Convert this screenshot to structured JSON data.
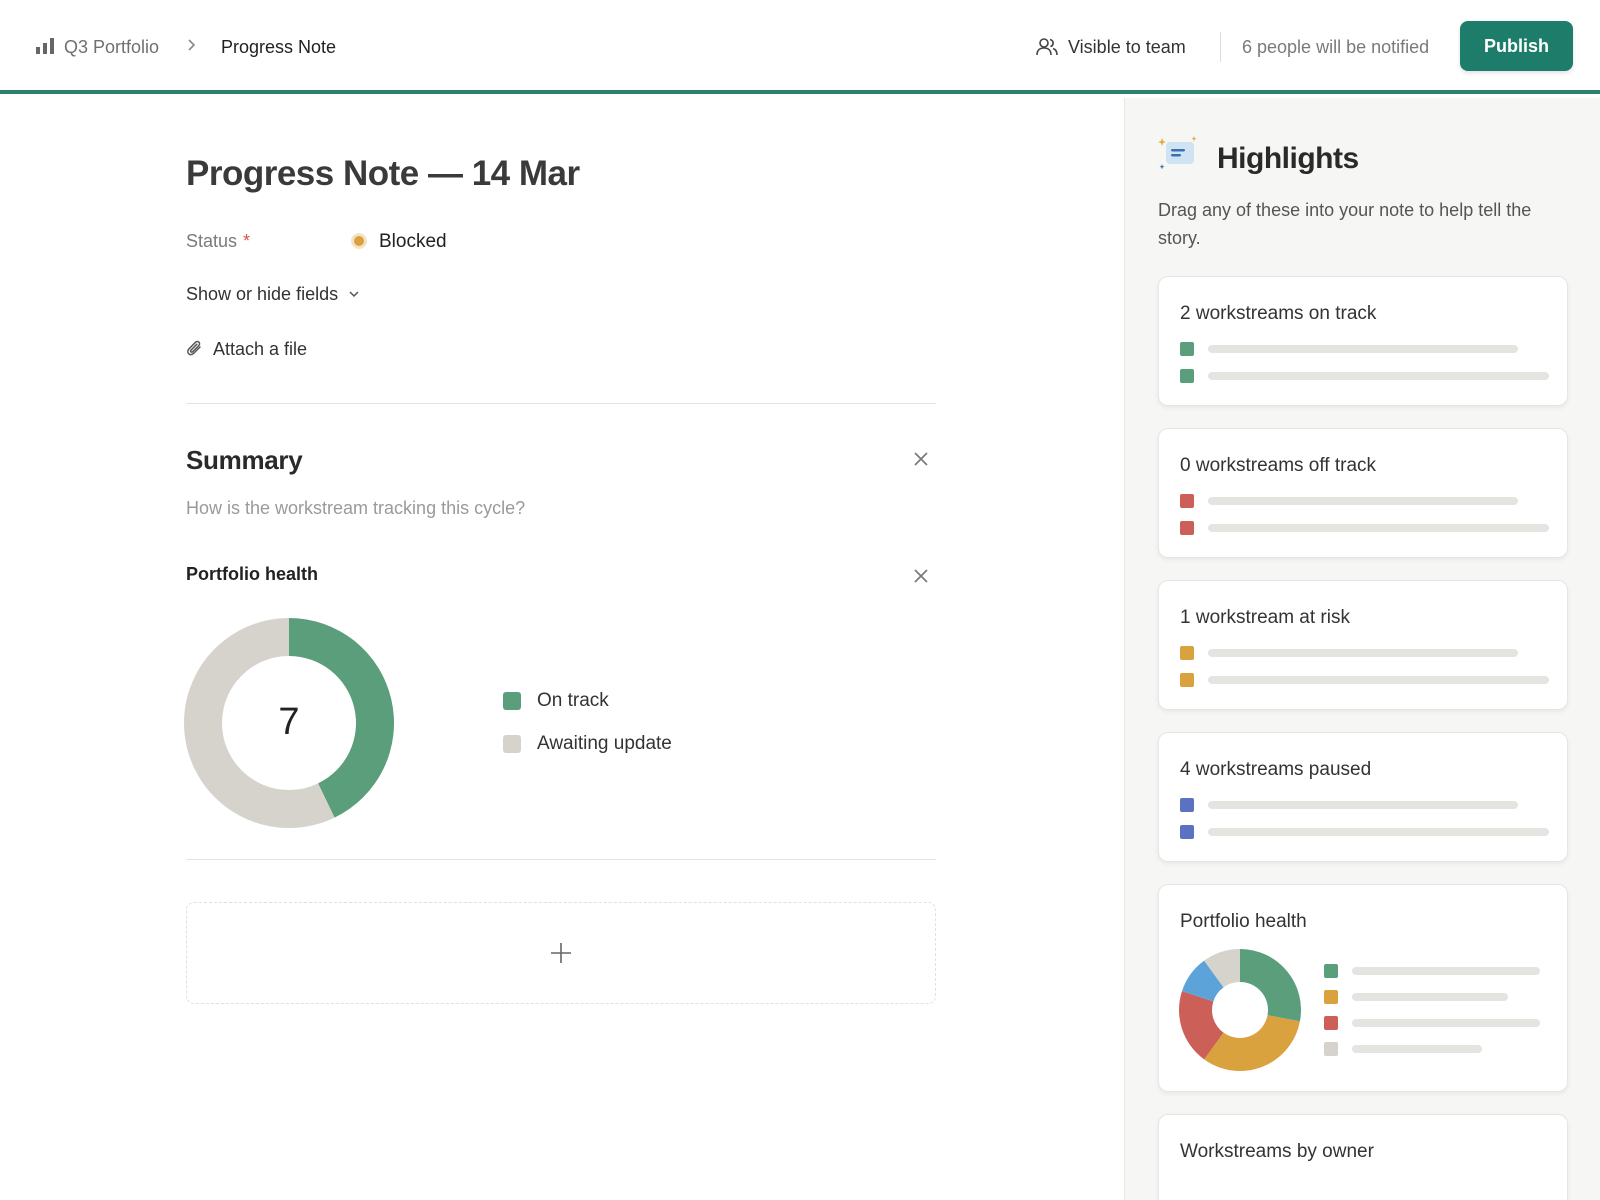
{
  "topbar": {
    "crumb_parent": "Q3 Portfolio",
    "crumb_current": "Progress Note",
    "visibility": "Visible to team",
    "notify": "6 people will be notified",
    "publish_label": "Publish"
  },
  "note": {
    "title": "Progress Note — 14 Mar",
    "status_label": "Status",
    "status_required_mark": "*",
    "status_value": "Blocked",
    "status_color": "#d9a23f",
    "show_hide_label": "Show or hide fields",
    "attach_label": "Attach a file"
  },
  "summary": {
    "heading": "Summary",
    "placeholder": "How is the workstream tracking this cycle?"
  },
  "health": {
    "heading": "Portfolio health",
    "total": "7",
    "chart_data": {
      "type": "pie",
      "categories": [
        "On track",
        "Awaiting update"
      ],
      "values": [
        3,
        4
      ],
      "colors": [
        "#5a9e7c",
        "#d6d3cc"
      ],
      "legend_position": "right"
    }
  },
  "highlights": {
    "title": "Highlights",
    "description": "Drag any of these into your note to help tell the story.",
    "cards": [
      {
        "title": "2 workstreams on track",
        "color": "#5a9e7c"
      },
      {
        "title": "0 workstreams off track",
        "color": "#cc5f57"
      },
      {
        "title": "1 workstream at risk",
        "color": "#d9a23f"
      },
      {
        "title": "4 workstreams paused",
        "color": "#5b72c2"
      }
    ],
    "health_card": {
      "title": "Portfolio health",
      "colors": [
        "#5a9e7c",
        "#d9a23f",
        "#cc5f57",
        "#5ba3d9",
        "#d6d3cc"
      ]
    },
    "owner_card": {
      "title": "Workstreams by owner"
    }
  },
  "icons": {
    "crumb": "bar-chart-icon",
    "separator": "chevron-right-icon",
    "visibility": "people-icon",
    "chevron": "chevron-down-icon",
    "attach": "paperclip-icon",
    "close": "close-icon",
    "add": "plus-icon",
    "highlights": "sparkle-chat-icon"
  }
}
